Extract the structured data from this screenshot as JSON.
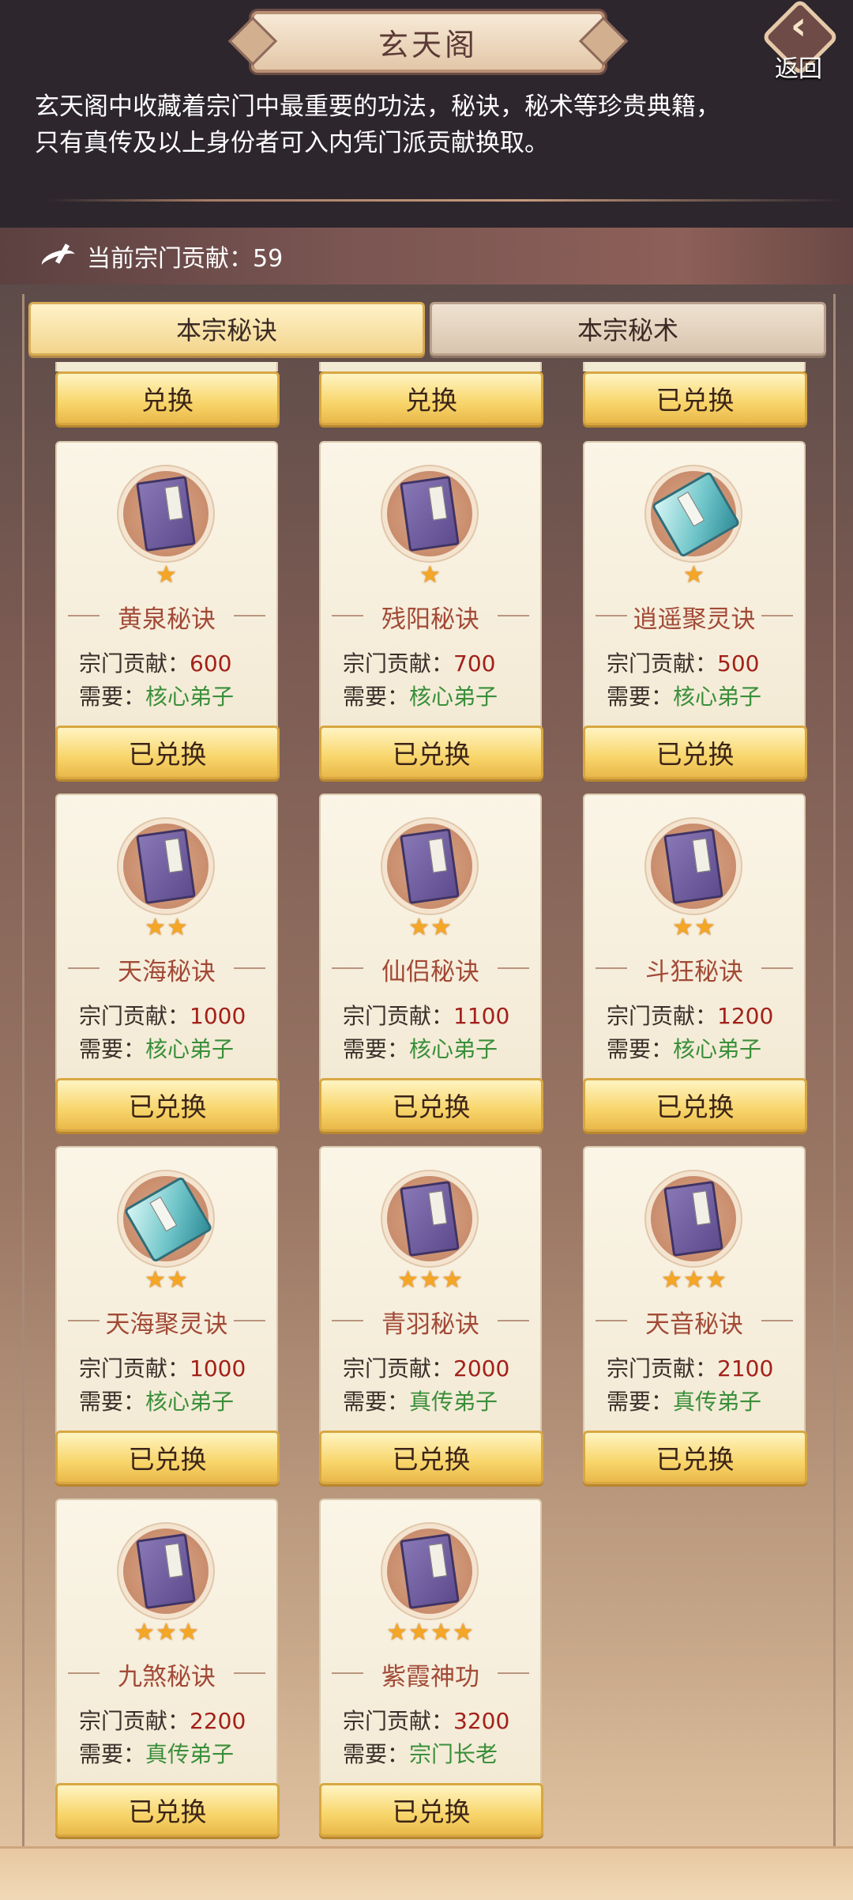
{
  "header": {
    "title": "玄天阁",
    "back_label": "返回",
    "intro_line1": "玄天阁中收藏着宗门中最重要的功法，秘诀，秘术等珍贵典籍，",
    "intro_line2": "只有真传及以上身份者可入内凭门派贡献换取。"
  },
  "contribution": {
    "label": "当前宗门贡献：59"
  },
  "tabs": [
    {
      "label": "本宗秘诀",
      "active": true
    },
    {
      "label": "本宗秘术",
      "active": false
    }
  ],
  "top_buttons": [
    "兑换",
    "兑换",
    "已兑换"
  ],
  "cost_label": "宗门贡献：",
  "req_label": "需要：",
  "items": [
    {
      "name": "黄泉秘诀",
      "stars": "★",
      "cost": "600",
      "req": "核心弟子",
      "button": "已兑换",
      "icon": "book-icon"
    },
    {
      "name": "残阳秘诀",
      "stars": "★",
      "cost": "700",
      "req": "核心弟子",
      "button": "已兑换",
      "icon": "book-icon"
    },
    {
      "name": "逍遥聚灵诀",
      "stars": "★",
      "cost": "500",
      "req": "核心弟子",
      "button": "已兑换",
      "icon": "scroll-icon"
    },
    {
      "name": "天海秘诀",
      "stars": "★★",
      "cost": "1000",
      "req": "核心弟子",
      "button": "已兑换",
      "icon": "book-icon"
    },
    {
      "name": "仙侣秘诀",
      "stars": "★★",
      "cost": "1100",
      "req": "核心弟子",
      "button": "已兑换",
      "icon": "book-icon"
    },
    {
      "name": "斗狂秘诀",
      "stars": "★★",
      "cost": "1200",
      "req": "核心弟子",
      "button": "已兑换",
      "icon": "book-icon"
    },
    {
      "name": "天海聚灵诀",
      "stars": "★★",
      "cost": "1000",
      "req": "核心弟子",
      "button": "已兑换",
      "icon": "scroll-icon"
    },
    {
      "name": "青羽秘诀",
      "stars": "★★★",
      "cost": "2000",
      "req": "真传弟子",
      "button": "已兑换",
      "icon": "book-icon"
    },
    {
      "name": "天音秘诀",
      "stars": "★★★",
      "cost": "2100",
      "req": "真传弟子",
      "button": "已兑换",
      "icon": "book-icon"
    },
    {
      "name": "九煞秘诀",
      "stars": "★★★",
      "cost": "2200",
      "req": "真传弟子",
      "button": "已兑换",
      "icon": "book-icon"
    },
    {
      "name": "紫霞神功",
      "stars": "★★★★",
      "cost": "3200",
      "req": "宗门长老",
      "button": "已兑换",
      "icon": "book-icon"
    }
  ]
}
